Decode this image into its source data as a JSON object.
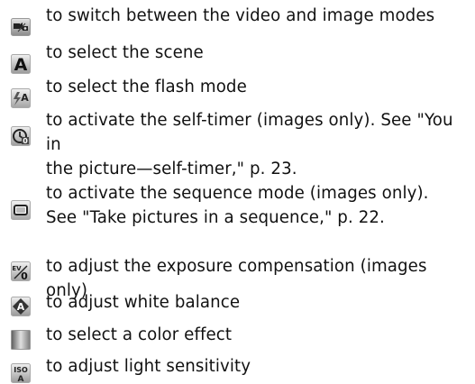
{
  "items": [
    {
      "icon": "camera-mode-switch-icon",
      "text": "to switch between the video and image modes"
    },
    {
      "icon": "scene-mode-icon",
      "text": "to select the scene"
    },
    {
      "icon": "flash-mode-icon",
      "text": "to select the flash mode"
    },
    {
      "icon": "self-timer-icon",
      "text": "to activate the self-timer (images only). See \"You in\nthe picture—self-timer,\" p. 23."
    },
    {
      "icon": "sequence-mode-icon",
      "text": "to activate the sequence mode (images only).\nSee \"Take pictures in a sequence,\" p. 22."
    },
    {
      "icon": "exposure-compensation-icon",
      "text": "to adjust the exposure compensation (images only)"
    },
    {
      "icon": "white-balance-icon",
      "text": "to adjust white balance"
    },
    {
      "icon": "color-effect-icon",
      "text": "to select a color effect"
    },
    {
      "icon": "iso-light-sensitivity-icon",
      "text": "to adjust light sensitivity"
    }
  ],
  "icon_glyphs": {
    "scene": "A",
    "exposure_ev": "EV",
    "exposure_zero": "0",
    "iso": "ISO",
    "iso_sub": "A"
  }
}
